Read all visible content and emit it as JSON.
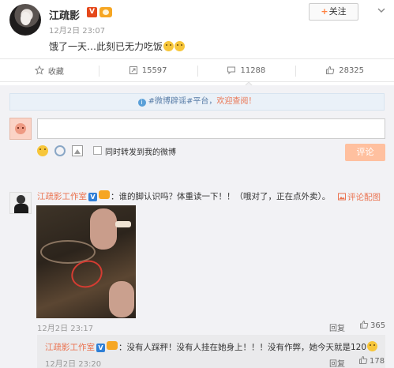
{
  "post": {
    "user_name": "江疏影",
    "verified_badge": "V",
    "time": "12月2日 23:07",
    "text": "饿了一天…此刻已无力吃饭",
    "follow_plus": "+",
    "follow_label": "关注"
  },
  "actions": {
    "favorite_label": "收藏",
    "repost_count": "15597",
    "comment_count": "11288",
    "like_count": "28325"
  },
  "comment_box": {
    "notice_text": "#微博辟谣#平台，",
    "notice_link": "欢迎查阅！",
    "repost_label": "同时转发到我的微博",
    "submit_label": "评论"
  },
  "comments": [
    {
      "user_name": "江疏影工作室",
      "verified_badge": "V",
      "text": "：谁的脚认识吗？体重读一下！！（哦对了，正在点外卖）。",
      "reply_link": "评论配图",
      "time": "12月2日 23:17",
      "reply_label": "回复",
      "likes": "365"
    }
  ],
  "sub_reply": {
    "user_name": "江疏影工作室",
    "verified_badge": "V",
    "text": "：没有人踩秤！没有人挂在她身上！！！没有作弊，她今天就是120",
    "time": "12月2日 23:20",
    "reply_label": "回复",
    "likes": "178"
  },
  "colors": {
    "accent": "#eb7350",
    "submit_disabled": "#ffc09f",
    "verified_red": "#e5481b",
    "verified_blue": "#2f7fd6"
  }
}
